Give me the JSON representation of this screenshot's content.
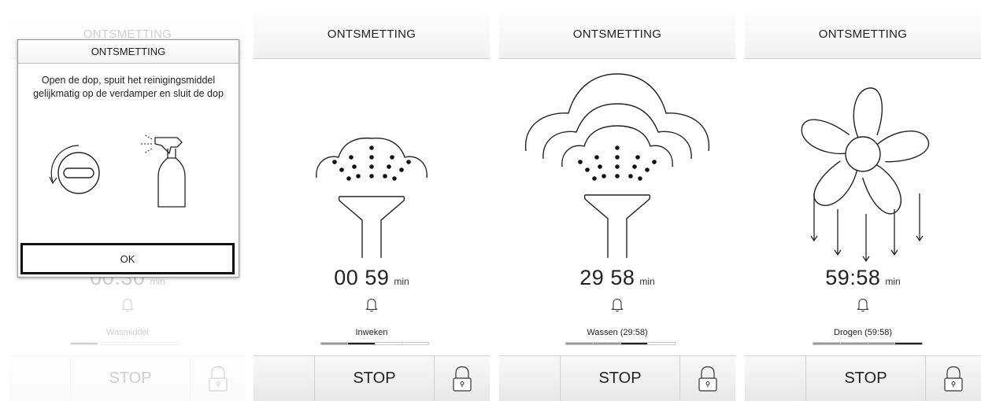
{
  "screens": [
    {
      "header": "ONTSMETTING",
      "timer": "00:30",
      "unit": "min",
      "phase": "Wasmiddel",
      "progress": {
        "total": 4,
        "active_index": 0
      },
      "stop_label": "STOP",
      "dialog": {
        "title": "ONTSMETTING",
        "message": "Open de dop, spuit het reinigingsmiddel gelijkmatig op de verdamper en sluit de dop",
        "ok_label": "OK"
      }
    },
    {
      "header": "ONTSMETTING",
      "timer": "00 59",
      "unit": "min",
      "phase": "Inweken",
      "progress": {
        "total": 4,
        "active_index": 1
      },
      "stop_label": "STOP"
    },
    {
      "header": "ONTSMETTING",
      "timer": "29 58",
      "unit": "min",
      "phase": "Wassen (29:58)",
      "progress": {
        "total": 4,
        "active_index": 2
      },
      "stop_label": "STOP"
    },
    {
      "header": "ONTSMETTING",
      "timer": "59:58",
      "unit": "min",
      "phase": "Drogen (59:58)",
      "progress": {
        "total": 4,
        "active_index": 3
      },
      "stop_label": "STOP"
    }
  ],
  "icons": [
    "rotate-cap-icon",
    "spray-bottle-icon",
    "shower-icon",
    "shower-waves-icon",
    "fan-icon",
    "bell-icon",
    "lock-icon"
  ],
  "colors": {
    "text": "#1e1e1e",
    "progress_done": "#9a9a9a",
    "progress_active": "#222222",
    "dialog_border": "#111111"
  }
}
